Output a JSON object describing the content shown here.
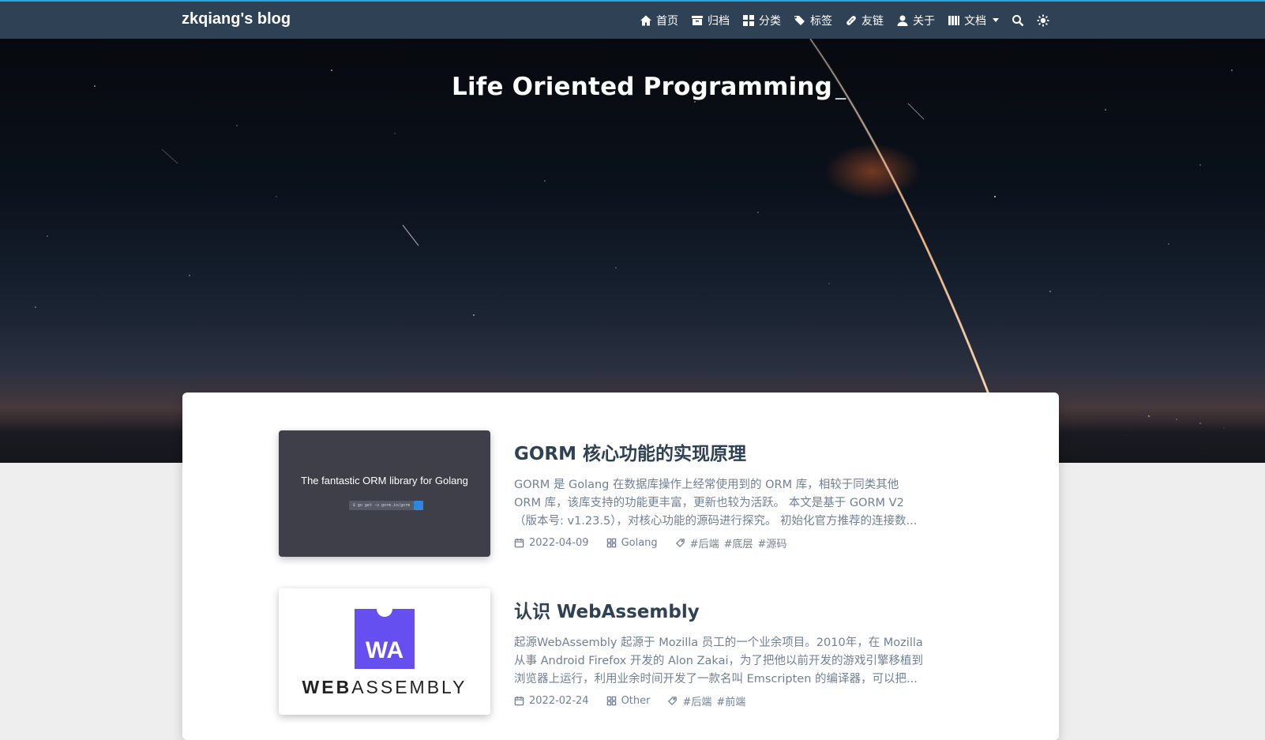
{
  "site": {
    "brand": "zkqiang's blog"
  },
  "nav": {
    "items": [
      {
        "icon": "home-icon",
        "label": "首页"
      },
      {
        "icon": "archive-icon",
        "label": "归档"
      },
      {
        "icon": "category-icon",
        "label": "分类"
      },
      {
        "icon": "tags-icon",
        "label": "标签"
      },
      {
        "icon": "link-icon",
        "label": "友链"
      },
      {
        "icon": "user-icon",
        "label": "关于"
      },
      {
        "icon": "docs-icon",
        "label": "文档",
        "dropdown": true
      }
    ],
    "search_icon": "search-icon",
    "theme_icon": "sun-icon"
  },
  "banner": {
    "headline": "Life Oriented Programming",
    "cursor": "_"
  },
  "colors": {
    "navbar": "#2f4154",
    "accent": "#29a3dc",
    "title": "#2f4154",
    "muted": "#718096",
    "wasm": "#654ff0"
  },
  "posts": [
    {
      "title": "GORM 核心功能的实现原理",
      "excerpt_lines": [
        "GORM 是 Golang 在数据库操作上经常使用到的 ORM 库，相较于同类其他",
        "ORM 库，该库支持的功能更丰富，更新也较为活跃。 本文是基于 GORM V2",
        "（版本号: v1.23.5），对核心功能的源码进行探究。 初始化官方推荐的连接数..."
      ],
      "date": "2022-04-09",
      "category": "Golang",
      "tags": [
        "#后端",
        "#底层",
        "#源码"
      ],
      "thumb": {
        "caption": "The fantastic ORM library for Golang",
        "command": "$ go get -u gorm.io/gorm"
      }
    },
    {
      "title": "认识 WebAssembly",
      "excerpt_lines": [
        "起源WebAssembly 起源于 Mozilla 员工的一个业余项目。2010年，在 Mozilla",
        "从事 Android Firefox 开发的 Alon Zakai，为了把他以前开发的游戏引擎移植到",
        "浏览器上运行，利用业余时间开发了一款名叫 Emscripten 的编译器，可以把..."
      ],
      "date": "2022-02-24",
      "category": "Other",
      "tags": [
        "#后端",
        "#前端"
      ],
      "thumb": {
        "logo_letters": "WA",
        "word_bold": "WEB",
        "word_rest": "ASSEMBLY"
      }
    }
  ]
}
